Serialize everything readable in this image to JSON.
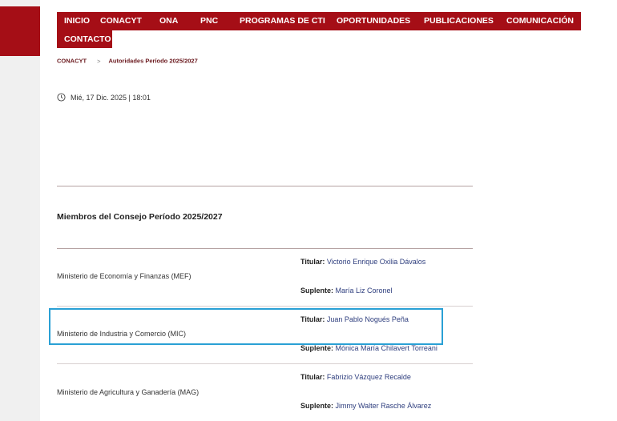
{
  "nav": {
    "items": [
      "INICIO",
      "CONACYT",
      "ONA",
      "PNC",
      "PROGRAMAS DE CTI",
      "OPORTUNIDADES",
      "PUBLICACIONES",
      "COMUNICACIÓN"
    ],
    "contact": "CONTACTO"
  },
  "breadcrumb": {
    "home": "CONACYT",
    "separator": ">",
    "current": "Autoridades Período 2025/2027"
  },
  "date": "Mié, 17 Dic. 2025 | 18:01",
  "section_title": "Miembros del Consejo Período 2025/2027",
  "labels": {
    "titular": "Titular",
    "suplente": "Suplente"
  },
  "members": [
    {
      "ministry": "Ministerio de Economía y Finanzas (MEF)",
      "titular": "Victorio Enrique Oxilia Dávalos",
      "suplente": "María Liz Coronel"
    },
    {
      "ministry": "Ministerio de Industria y Comercio (MIC)",
      "titular": "Juan Pablo Nogués Peña",
      "suplente": "Mónica María Chilavert Torreani"
    },
    {
      "ministry": "Ministerio de Agricultura y Ganadería (MAG)",
      "titular": "Fabrizio Vázquez Recalde",
      "suplente": "Jimmy Walter Rasche Álvarez"
    }
  ],
  "colors": {
    "brand_red": "#a50e16",
    "highlight_blue": "#2aa0d5",
    "name_blue": "#2e3e7e"
  }
}
